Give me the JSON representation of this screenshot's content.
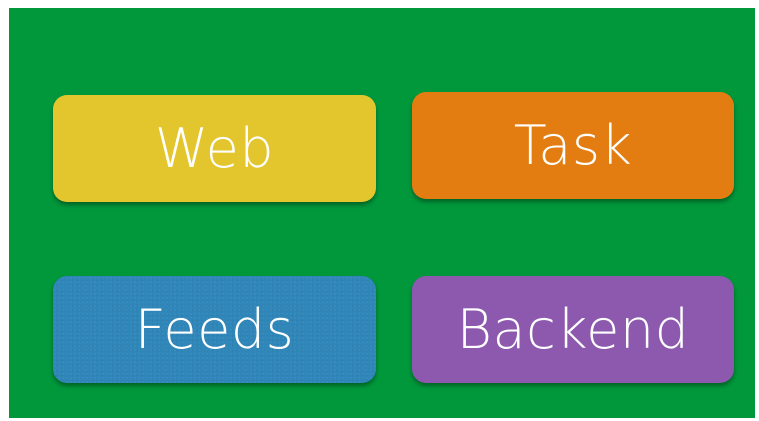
{
  "colors": {
    "background": "#01983b",
    "web": "#e3c52d",
    "task": "#e37d11",
    "feeds": "#2f86b8",
    "backend": "#8c59ae"
  },
  "tiles": [
    {
      "id": "web",
      "label": "Web"
    },
    {
      "id": "task",
      "label": "Task"
    },
    {
      "id": "feeds",
      "label": "Feeds"
    },
    {
      "id": "backend",
      "label": "Backend"
    }
  ]
}
